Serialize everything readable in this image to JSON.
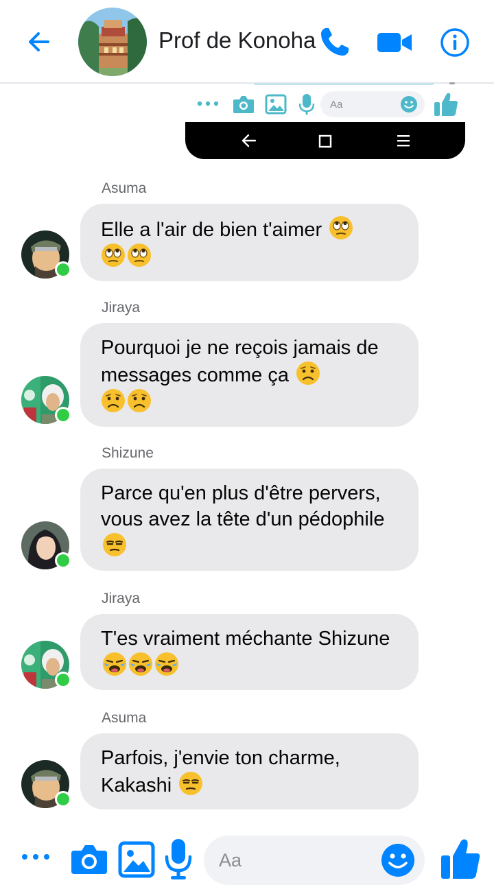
{
  "header": {
    "title": "Prof de Konoha",
    "icons": [
      "arrow-left-icon",
      "phone-icon",
      "video-camera-icon",
      "info-icon"
    ],
    "accent": "#0084ff"
  },
  "embedded_screenshot": {
    "input_placeholder": "Aa"
  },
  "messages": [
    {
      "sender": "Asuma",
      "text": "Elle a l'air de bien t'aimer",
      "emoji": [
        "eye-roll",
        "eye-roll",
        "eye-roll"
      ]
    },
    {
      "sender": "Jiraya",
      "text": "Pourquoi je ne reçois jamais de messages comme ça",
      "emoji": [
        "frown",
        "frown",
        "frown"
      ]
    },
    {
      "sender": "Shizune",
      "text": "Parce qu'en plus d'être pervers, vous avez la tête d'un pédophile",
      "emoji": [
        "unamused"
      ]
    },
    {
      "sender": "Jiraya",
      "text": "T'es vraiment méchante Shizune",
      "emoji": [
        "crying",
        "crying",
        "crying"
      ]
    },
    {
      "sender": "Asuma",
      "text": "Parfois, j'envie ton charme, Kakashi",
      "emoji": [
        "unamused"
      ]
    }
  ],
  "composer": {
    "placeholder": "Aa",
    "icons": [
      "more-dots-icon",
      "camera-icon",
      "image-icon",
      "microphone-icon",
      "emoji-icon",
      "thumbs-up-icon"
    ]
  },
  "colors": {
    "accent": "#0084ff",
    "bubble": "#e9e9eb",
    "online": "#31cc46",
    "emoji": "#f7c02c"
  }
}
